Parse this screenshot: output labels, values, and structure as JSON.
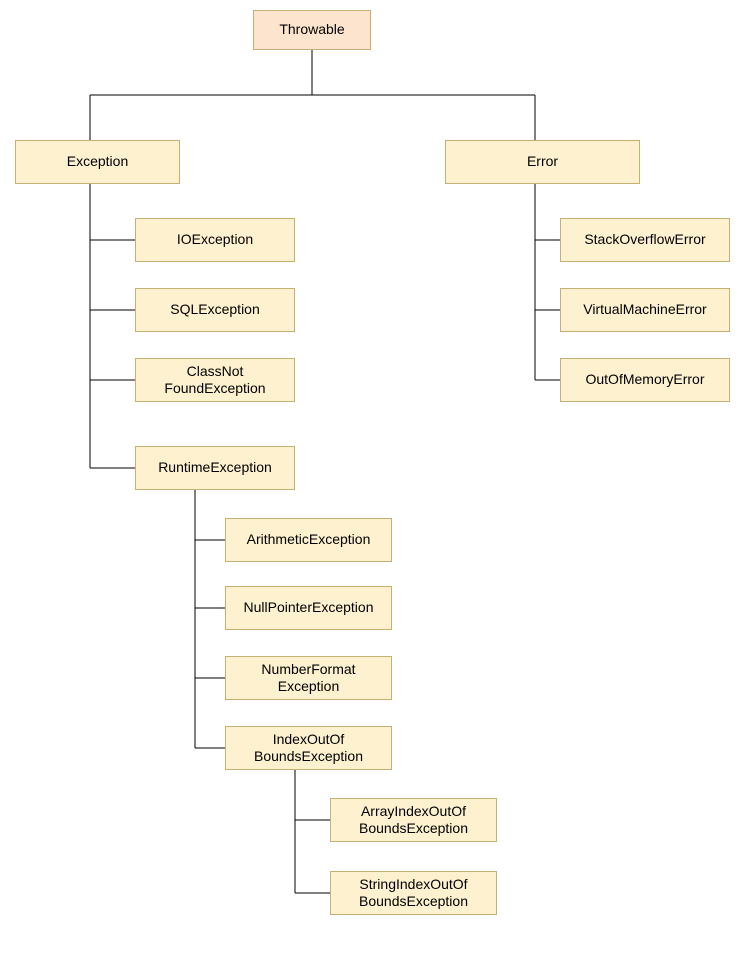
{
  "root": {
    "label": "Throwable"
  },
  "left": {
    "exception": "Exception",
    "children": {
      "io": "IOException",
      "sql": "SQLException",
      "cnf_line1": "ClassNot",
      "cnf_line2": "FoundException",
      "runtime": "RuntimeException"
    },
    "runtime_children": {
      "arith": "ArithmeticException",
      "npe": "NullPointerException",
      "nfe_line1": "NumberFormat",
      "nfe_line2": "Exception",
      "ioob_line1": "IndexOutOf",
      "ioob_line2": "BoundsException"
    },
    "ioob_children": {
      "aioob_line1": "ArrayIndexOutOf",
      "aioob_line2": "BoundsException",
      "sioob_line1": "StringIndexOutOf",
      "sioob_line2": "BoundsException"
    }
  },
  "right": {
    "error": "Error",
    "children": {
      "soe": "StackOverflowError",
      "vme": "VirtualMachineError",
      "oom": "OutOfMemoryError"
    }
  }
}
